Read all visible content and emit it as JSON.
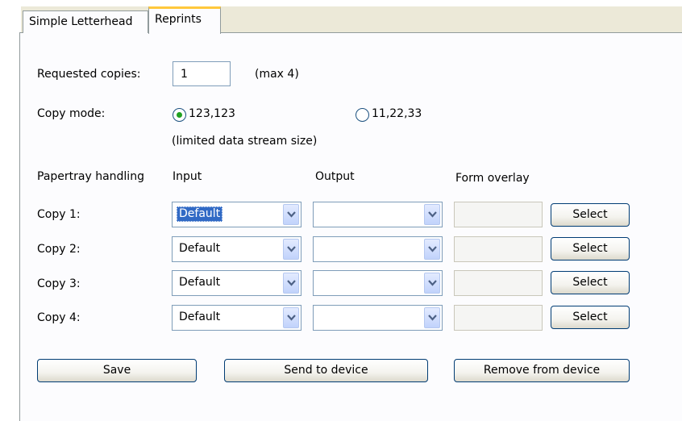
{
  "tabs": [
    {
      "label": "Simple Letterhead",
      "active": false
    },
    {
      "label": "Reprints",
      "active": true
    }
  ],
  "requested_copies": {
    "label": "Requested copies:",
    "value": "1",
    "hint": "(max 4)"
  },
  "copy_mode": {
    "label": "Copy mode:",
    "options": [
      {
        "label": "123,123",
        "selected": true
      },
      {
        "label": "11,22,33",
        "selected": false
      }
    ],
    "note": "(limited data stream size)"
  },
  "papertray": {
    "heading": "Papertray handling",
    "columns": {
      "input": "Input",
      "output": "Output",
      "form_overlay": "Form overlay"
    },
    "rows": [
      {
        "label": "Copy 1:",
        "input": "Default",
        "output": "",
        "overlay": "",
        "select_label": "Select"
      },
      {
        "label": "Copy 2:",
        "input": "Default",
        "output": "",
        "overlay": "",
        "select_label": "Select"
      },
      {
        "label": "Copy 3:",
        "input": "Default",
        "output": "",
        "overlay": "",
        "select_label": "Select"
      },
      {
        "label": "Copy 4:",
        "input": "Default",
        "output": "",
        "overlay": "",
        "select_label": "Select"
      }
    ]
  },
  "actions": {
    "save": "Save",
    "send": "Send to device",
    "remove": "Remove from device"
  },
  "colors": {
    "tab_highlight": "#ffc83c",
    "selection": "#316ac5",
    "radio_dot": "#21a121",
    "dialog_bg": "#ece9d8"
  }
}
